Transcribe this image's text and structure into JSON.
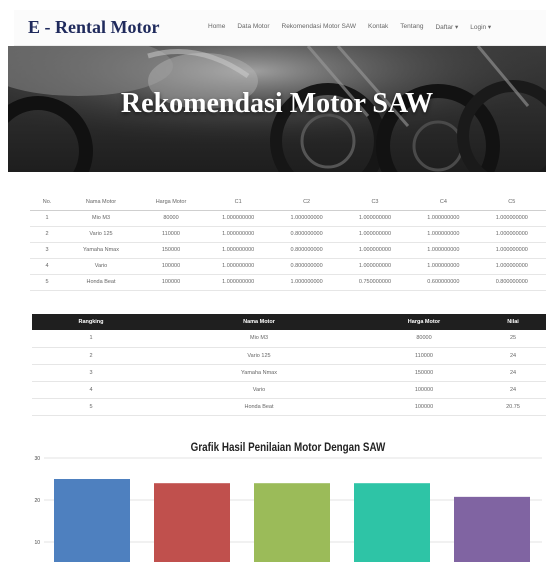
{
  "header": {
    "brand": "E - Rental Motor",
    "nav": [
      "Home",
      "Data Motor",
      "Rekomendasi Motor SAW",
      "Kontak",
      "Tentang",
      "Daftar ▾",
      "Login ▾"
    ]
  },
  "hero": {
    "title": "Rekomendasi Motor SAW"
  },
  "matrix_table": {
    "headers": [
      "No.",
      "Nama Motor",
      "Harga Motor",
      "C1",
      "C2",
      "C3",
      "C4",
      "C5"
    ],
    "rows": [
      [
        "1",
        "Mio M3",
        "80000",
        "1.000000000",
        "1.000000000",
        "1.000000000",
        "1.000000000",
        "1.000000000"
      ],
      [
        "2",
        "Vario 125",
        "110000",
        "1.000000000",
        "0.800000000",
        "1.000000000",
        "1.000000000",
        "1.000000000"
      ],
      [
        "3",
        "Yamaha Nmax",
        "150000",
        "1.000000000",
        "0.800000000",
        "1.000000000",
        "1.000000000",
        "1.000000000"
      ],
      [
        "4",
        "Vario",
        "100000",
        "1.000000000",
        "0.800000000",
        "1.000000000",
        "1.000000000",
        "1.000000000"
      ],
      [
        "5",
        "Honda Beat",
        "100000",
        "1.000000000",
        "1.000000000",
        "0.750000000",
        "0.600000000",
        "0.800000000"
      ]
    ]
  },
  "ranking_table": {
    "headers": [
      "Rangking",
      "Nama Motor",
      "Harga Motor",
      "Nilai"
    ],
    "rows": [
      [
        "1",
        "Mio M3",
        "80000",
        "25"
      ],
      [
        "2",
        "Vario 125",
        "110000",
        "24"
      ],
      [
        "3",
        "Yamaha Nmax",
        "150000",
        "24"
      ],
      [
        "4",
        "Vario",
        "100000",
        "24"
      ],
      [
        "5",
        "Honda Beat",
        "100000",
        "20.75"
      ]
    ]
  },
  "chart_data": {
    "type": "bar",
    "title": "Grafik Hasil Penilaian Motor Dengan SAW",
    "values": [
      25,
      24,
      24,
      24,
      20.75
    ],
    "colors": [
      "#4e80bf",
      "#c0504d",
      "#9bbb59",
      "#2ec4a6",
      "#8064a2"
    ],
    "yticks": [
      10,
      20,
      30
    ],
    "ylim": [
      5,
      30
    ],
    "xlabel": "",
    "ylabel": ""
  }
}
